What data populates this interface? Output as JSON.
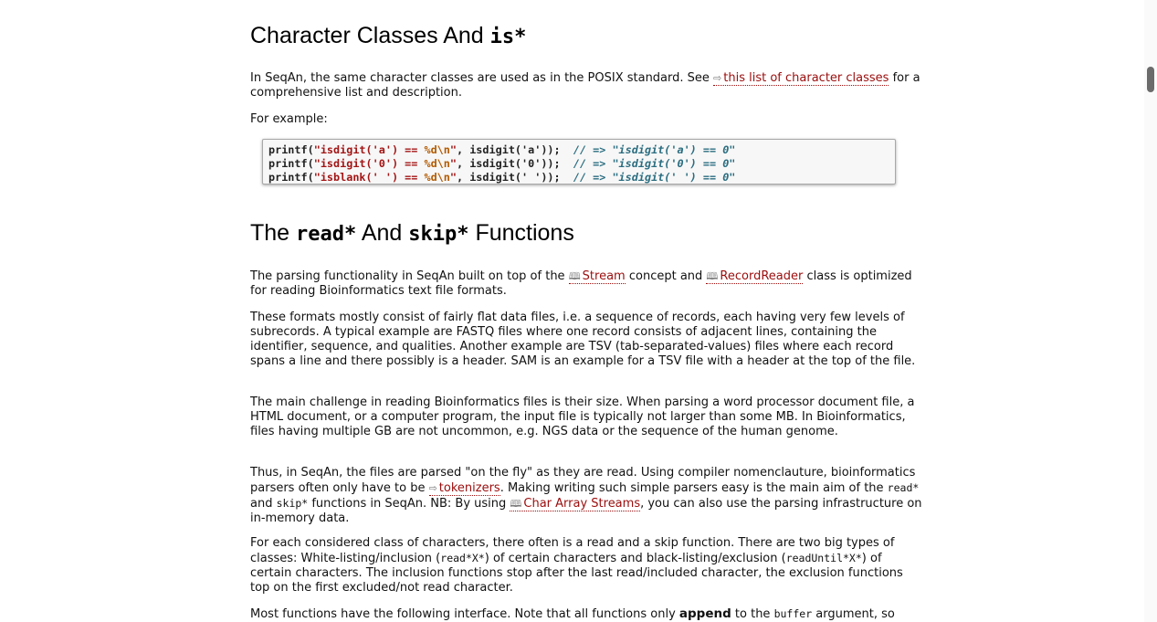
{
  "sections": {
    "char_classes": {
      "title_text": "Character Classes And ",
      "title_code": "is*",
      "intro_before_link": "In SeqAn, the same character classes are used as in the POSIX standard. See ",
      "intro_link_icon": "⇨",
      "intro_link": "this list of character classes",
      "intro_after_link": " for a comprehensive list and description.",
      "example_label": "For example:",
      "code_lines": [
        {
          "pre": "printf(",
          "str1": "\"isdigit('a') == ",
          "esc": "%d\\n",
          "str2": "\"",
          "mid": ", isdigit('a'));  ",
          "comment": "// => \"isdigit('a') == 0\""
        },
        {
          "pre": "printf(",
          "str1": "\"isdigit('0') == ",
          "esc": "%d\\n",
          "str2": "\"",
          "mid": ", isdigit('0'));  ",
          "comment": "// => \"isdigit('0') == 0\""
        },
        {
          "pre": "printf(",
          "str1": "\"isblank(' ') == ",
          "esc": "%d\\n",
          "str2": "\"",
          "mid": ", isdigit(' '));  ",
          "comment": "// => \"isdigit(' ') == 0\""
        }
      ]
    },
    "read_skip": {
      "title_text1": "The ",
      "title_code1": "read*",
      "title_text2": " And ",
      "title_code2": "skip*",
      "title_text3": " Functions",
      "p1_a": "The parsing functionality in SeqAn built on top of the ",
      "p1_link1": "Stream",
      "p1_b": " concept and ",
      "p1_link2": "RecordReader",
      "p1_c": " class is optimized for reading Bioinformatics text file formats.",
      "doc_icon": "🕮",
      "p2": "These formats mostly consist of fairly flat data files, i.e. a sequence of records, each having very few levels of subrecords. A typical example are FASTQ files where one record consists of adjacent lines, containing the identifier, sequence, and qualities. Another example are TSV (tab-separated-values) files where each record spans a line and there possibly is a header. SAM is an example for a TSV file with a header at the top of the file.",
      "p3": "The main challenge in reading Bioinformatics files is their size. When parsing a word processor document file, a HTML document, or a computer program, the input file is typically not larger than some MB. In Bioinformatics, files having multiple GB are not uncommon, e.g. NGS data or the sequence of the human genome.",
      "p4_a": "Thus, in SeqAn, the files are parsed \"on the fly\" as they are read. Using compiler nomenclauture, bioinformatics parsers often only have to be ",
      "p4_link_icon": "⇨",
      "p4_link1": "tokenizers",
      "p4_b": ". Making writing such simple parsers easy is the main aim of the ",
      "p4_code1": "read*",
      "p4_c": " and ",
      "p4_code2": "skip*",
      "p4_d": " functions in SeqAn. NB: By using ",
      "p4_link2": "Char Array Streams",
      "p4_e": ", you can also use the parsing infrastructure on in-memory data.",
      "p5_a": "For each considered class of characters, there often is a read and a skip function. There are two big types of classes: White-listing/inclusion (",
      "p5_code1": "read*X*",
      "p5_b": ") of certain characters and black-listing/exclusion (",
      "p5_code2": "readUntil*X*",
      "p5_c": ") of certain characters. The inclusion functions stop after the last read/included character, the exclusion functions top on the first excluded/not read character.",
      "p6_a": "Most functions have the following interface. Note that all functions only ",
      "p6_bold": "append",
      "p6_b": " to the ",
      "p6_code": "buffer",
      "p6_c": " argument, so"
    }
  }
}
